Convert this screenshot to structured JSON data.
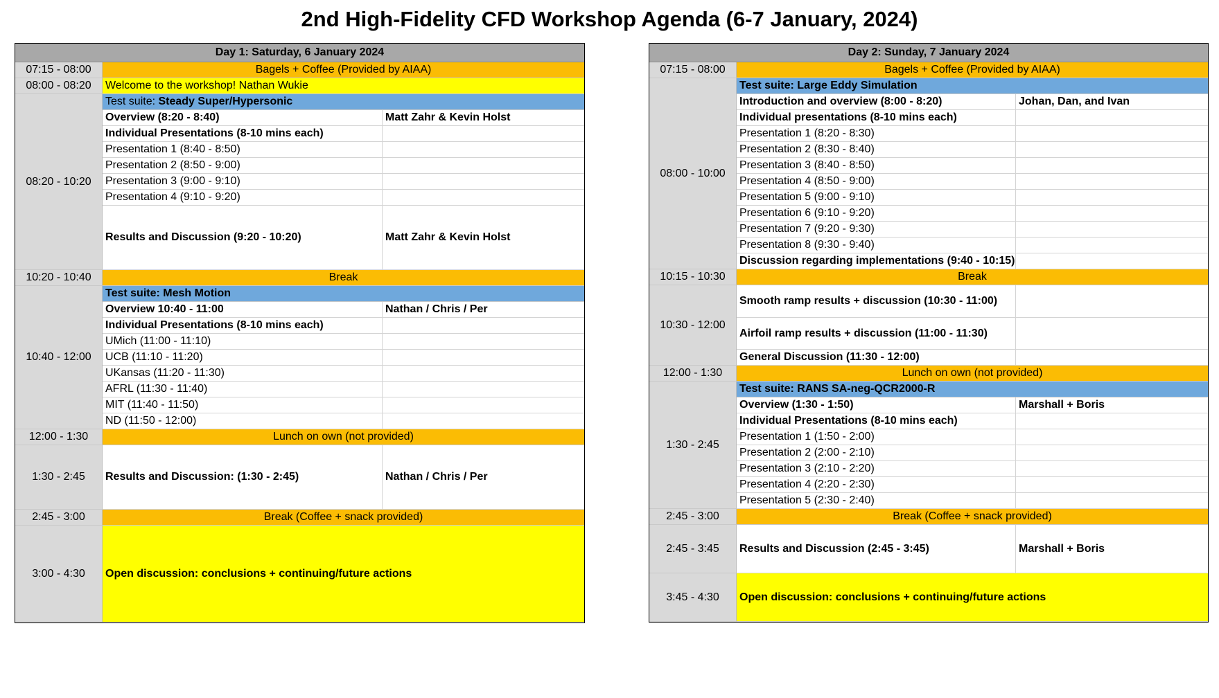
{
  "title": "2nd High-Fidelity CFD Workshop Agenda (6-7 January, 2024)",
  "day1": {
    "header": "Day 1: Saturday, 6 January 2024",
    "blocks": [
      {
        "time": "07:15 - 08:00",
        "rows": [
          {
            "type": "orange",
            "text": "Bagels + Coffee (Provided by AIAA)",
            "h": 23
          }
        ]
      },
      {
        "time": "08:00 - 08:20",
        "rows": [
          {
            "type": "yellow",
            "text": "Welcome to the workshop! Nathan Wukie",
            "h": 23
          }
        ]
      },
      {
        "time": "08:20 - 10:20",
        "rows": [
          {
            "type": "blue",
            "text": "Test suite: ",
            "bold_text": "Steady Super/Hypersonic",
            "h": 23
          },
          {
            "type": "split",
            "text": "Overview (8:20 - 8:40)",
            "bold": true,
            "who": "Matt Zahr & Kevin Holst",
            "h": 23
          },
          {
            "type": "split",
            "text": "Individual Presentations (8-10 mins each)",
            "bold": true,
            "who": "",
            "h": 23
          },
          {
            "type": "split",
            "text": "Presentation 1 (8:40 - 8:50)",
            "who": "",
            "h": 23
          },
          {
            "type": "split",
            "text": "Presentation 2 (8:50 - 9:00)",
            "who": "",
            "h": 23
          },
          {
            "type": "split",
            "text": "Presentation 3 (9:00 - 9:10)",
            "who": "",
            "h": 23
          },
          {
            "type": "split",
            "text": "Presentation 4 (9:10 - 9:20)",
            "who": "",
            "h": 23
          },
          {
            "type": "split",
            "text": "Results and Discussion (9:20 - 10:20)",
            "bold": true,
            "who": "Matt Zahr & Kevin Holst",
            "h": 93
          }
        ]
      },
      {
        "time": "10:20 - 10:40",
        "rows": [
          {
            "type": "orange",
            "text": "Break",
            "h": 23
          }
        ]
      },
      {
        "time": "10:40 - 12:00",
        "rows": [
          {
            "type": "blue",
            "bold_text": "Test suite: Mesh Motion",
            "h": 23
          },
          {
            "type": "split",
            "text": "Overview 10:40 - 11:00",
            "bold": true,
            "who": "Nathan / Chris / Per",
            "h": 23
          },
          {
            "type": "split",
            "text": "Individual Presentations (8-10 mins each)",
            "bold": true,
            "who": "",
            "h": 23
          },
          {
            "type": "split",
            "text": "UMich (11:00 - 11:10)",
            "who": "",
            "h": 23
          },
          {
            "type": "split",
            "text": "UCB (11:10 - 11:20)",
            "who": "",
            "h": 23
          },
          {
            "type": "split",
            "text": "UKansas (11:20 - 11:30)",
            "who": "",
            "h": 23
          },
          {
            "type": "split",
            "text": "AFRL (11:30 - 11:40)",
            "who": "",
            "h": 23
          },
          {
            "type": "split",
            "text": "MIT (11:40 - 11:50)",
            "who": "",
            "h": 23
          },
          {
            "type": "split",
            "text": "ND (11:50 - 12:00)",
            "who": "",
            "h": 23
          }
        ]
      },
      {
        "time": "12:00 - 1:30",
        "rows": [
          {
            "type": "orange",
            "text": "Lunch on own (not provided)",
            "h": 23
          }
        ]
      },
      {
        "time": "1:30 - 2:45",
        "rows": [
          {
            "type": "split",
            "text": "Results and Discussion: (1:30 - 2:45)",
            "bold": true,
            "who": "Nathan / Chris / Per",
            "h": 93
          }
        ]
      },
      {
        "time": "2:45 - 3:00",
        "rows": [
          {
            "type": "orange",
            "text": "Break (Coffee + snack provided)",
            "h": 23
          }
        ]
      },
      {
        "time": "3:00 - 4:30",
        "rows": [
          {
            "type": "yellow",
            "text": "Open discussion: conclusions + continuing/future actions",
            "bold": true,
            "h": 140
          }
        ]
      }
    ]
  },
  "day2": {
    "header": "Day 2: Sunday, 7 January 2024",
    "blocks": [
      {
        "time": "07:15 - 08:00",
        "rows": [
          {
            "type": "orange",
            "text": "Bagels + Coffee (Provided by AIAA)",
            "h": 23
          }
        ]
      },
      {
        "time": "08:00 - 10:00",
        "rows": [
          {
            "type": "blue",
            "bold_text": "Test suite: Large Eddy Simulation",
            "h": 23
          },
          {
            "type": "split",
            "text": "Introduction and overview (8:00 - 8:20)",
            "bold": true,
            "who": "Johan, Dan, and Ivan",
            "h": 23
          },
          {
            "type": "split",
            "text": "Individual presentations (8-10 mins each)",
            "bold": true,
            "who": "",
            "h": 23
          },
          {
            "type": "split",
            "text": "Presentation 1 (8:20 - 8:30)",
            "who": "",
            "h": 23
          },
          {
            "type": "split",
            "text": "Presentation 2 (8:30 - 8:40)",
            "who": "",
            "h": 23
          },
          {
            "type": "split",
            "text": "Presentation 3 (8:40 - 8:50)",
            "who": "",
            "h": 23
          },
          {
            "type": "split",
            "text": "Presentation 4 (8:50 - 9:00)",
            "who": "",
            "h": 23
          },
          {
            "type": "split",
            "text": "Presentation 5 (9:00 - 9:10)",
            "who": "",
            "h": 23
          },
          {
            "type": "split",
            "text": "Presentation 6 (9:10 - 9:20)",
            "who": "",
            "h": 23
          },
          {
            "type": "split",
            "text": "Presentation 7 (9:20 - 9:30)",
            "who": "",
            "h": 23
          },
          {
            "type": "split",
            "text": "Presentation 8 (9:30 - 9:40)",
            "who": "",
            "h": 23
          },
          {
            "type": "split",
            "text": "Discussion regarding implementations (9:40 - 10:15)",
            "bold": true,
            "who": "",
            "h": 23
          }
        ]
      },
      {
        "time": "10:15 - 10:30",
        "rows": [
          {
            "type": "orange",
            "text": "Break",
            "h": 23
          }
        ]
      },
      {
        "time": "10:30 - 12:00",
        "rows": [
          {
            "type": "split",
            "text": "Smooth ramp results + discussion (10:30 - 11:00)",
            "bold": true,
            "who": "",
            "h": 47
          },
          {
            "type": "split",
            "text": "Airfoil ramp results + discussion (11:00 - 11:30)",
            "bold": true,
            "who": "",
            "h": 46
          },
          {
            "type": "split",
            "text": "General Discussion (11:30 - 12:00)",
            "bold": true,
            "who": "",
            "h": 23
          }
        ]
      },
      {
        "time": "12:00 - 1:30",
        "rows": [
          {
            "type": "orange",
            "text": "Lunch on own (not provided)",
            "h": 23
          }
        ]
      },
      {
        "time": "1:30 - 2:45",
        "rows": [
          {
            "type": "blue",
            "bold_text": "Test suite: RANS SA-neg-QCR2000-R",
            "h": 23
          },
          {
            "type": "split",
            "text": "Overview (1:30 - 1:50)",
            "bold": true,
            "who": "Marshall + Boris",
            "h": 23
          },
          {
            "type": "split",
            "text": "Individual Presentations (8-10 mins each)",
            "bold": true,
            "who": "",
            "h": 23
          },
          {
            "type": "split",
            "text": "Presentation 1 (1:50 - 2:00)",
            "who": "",
            "h": 23
          },
          {
            "type": "split",
            "text": "Presentation 2 (2:00 - 2:10)",
            "who": "",
            "h": 23
          },
          {
            "type": "split",
            "text": "Presentation 3 (2:10 - 2:20)",
            "who": "",
            "h": 23
          },
          {
            "type": "split",
            "text": "Presentation 4 (2:20 - 2:30)",
            "who": "",
            "h": 23
          },
          {
            "type": "split",
            "text": "Presentation 5 (2:30 - 2:40)",
            "who": "",
            "h": 23
          }
        ]
      },
      {
        "time": "2:45 - 3:00",
        "rows": [
          {
            "type": "orange",
            "text": "Break (Coffee + snack provided)",
            "h": 23
          }
        ]
      },
      {
        "time": "2:45 - 3:45",
        "rows": [
          {
            "type": "split",
            "text": "Results and Discussion (2:45 - 3:45)",
            "bold": true,
            "who": "Marshall + Boris",
            "h": 70
          }
        ]
      },
      {
        "time": "3:45 - 4:30",
        "rows": [
          {
            "type": "yellow",
            "text": "Open discussion: conclusions + continuing/future actions",
            "bold": true,
            "h": 70
          }
        ]
      }
    ]
  }
}
